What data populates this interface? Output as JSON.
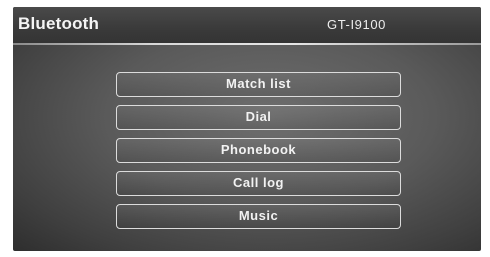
{
  "header": {
    "title": "Bluetooth",
    "device_name": "GT-I9100"
  },
  "menu": {
    "items": [
      {
        "label": "Match list"
      },
      {
        "label": "Dial"
      },
      {
        "label": "Phonebook"
      },
      {
        "label": "Call log"
      },
      {
        "label": "Music"
      }
    ]
  },
  "colors": {
    "background": "#5a5a5a",
    "header": "#3a3a3a",
    "text": "#f2f2f2",
    "button_border": "#dcdcdc"
  }
}
